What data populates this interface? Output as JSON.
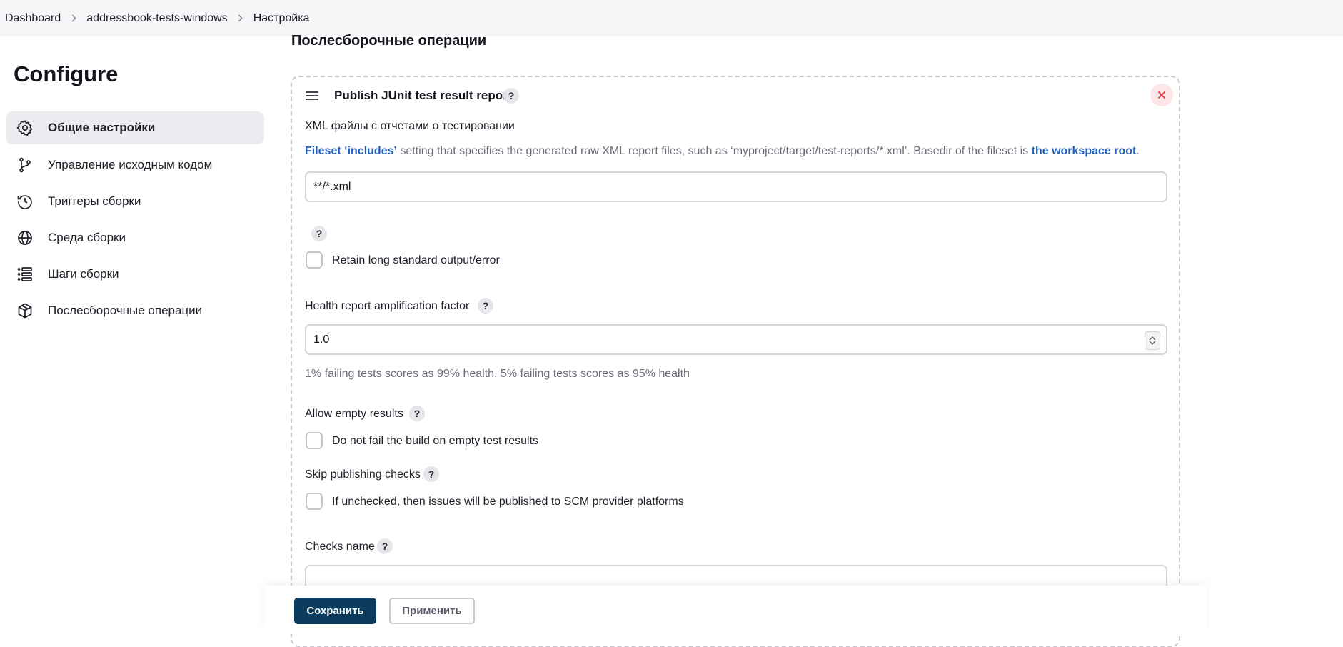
{
  "breadcrumb": {
    "items": [
      "Dashboard",
      "addressbook-tests-windows",
      "Настройка"
    ]
  },
  "sidebar": {
    "title": "Configure",
    "items": [
      {
        "label": "Общие настройки",
        "icon": "gear-icon",
        "active": true
      },
      {
        "label": "Управление исходным кодом",
        "icon": "git-branch-icon",
        "active": false
      },
      {
        "label": "Триггеры сборки",
        "icon": "clock-icon",
        "active": false
      },
      {
        "label": "Среда сборки",
        "icon": "globe-icon",
        "active": false
      },
      {
        "label": "Шаги сборки",
        "icon": "list-icon",
        "active": false
      },
      {
        "label": "Послесборочные операции",
        "icon": "package-icon",
        "active": false
      }
    ]
  },
  "main": {
    "section_title": "Послесборочные операции",
    "card": {
      "title": "Publish JUnit test result report",
      "help": "?",
      "xml": {
        "label": "XML файлы с отчетами о тестировании",
        "desc_link1": "Fileset ‘includes’",
        "desc_text": " setting that specifies the generated raw XML report files, such as ‘myproject/target/test-reports/*.xml’. Basedir of the fileset is ",
        "desc_link2": "the workspace root",
        "desc_end": ".",
        "value": "**/*.xml"
      },
      "retain": {
        "label": "Retain long standard output/error",
        "checked": false
      },
      "health": {
        "label": "Health report amplification factor",
        "value": "1.0",
        "desc": "1% failing tests scores as 99% health. 5% failing tests scores as 95% health"
      },
      "allow_empty": {
        "label": "Allow empty results",
        "checkbox_label": "Do not fail the build on empty test results",
        "checked": false
      },
      "skip_publishing": {
        "label": "Skip publishing checks",
        "checkbox_label": "If unchecked, then issues will be published to SCM provider platforms",
        "checked": false
      },
      "checks_name": {
        "label": "Checks name",
        "value": ""
      }
    }
  },
  "footer": {
    "save_label": "Сохранить",
    "apply_label": "Применить"
  },
  "colors": {
    "accent": "#0b3c5d",
    "link": "#1d5fbf",
    "danger": "#e3343f"
  }
}
